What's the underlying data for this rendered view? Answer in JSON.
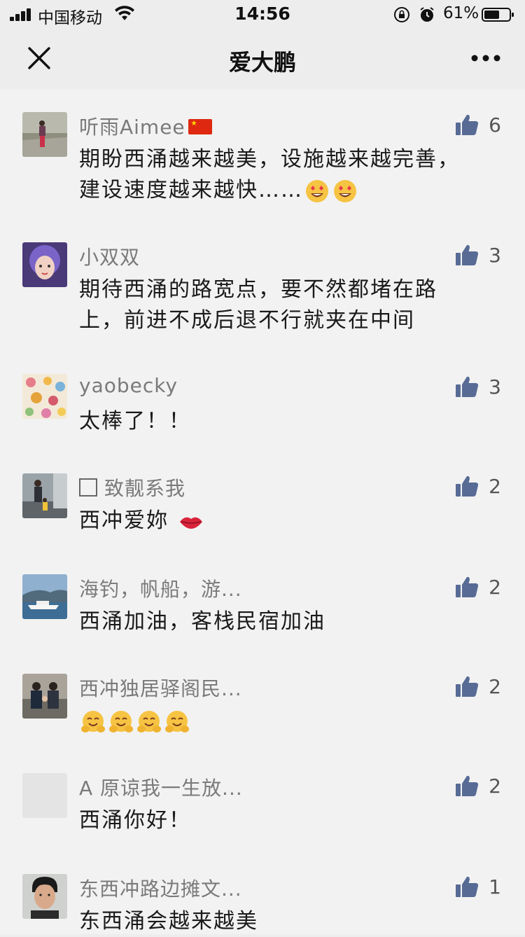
{
  "status": {
    "carrier": "中国移动",
    "time": "14:56",
    "battery": "61%",
    "battery_level": 0.61
  },
  "nav": {
    "title": "爱大鹏"
  },
  "comments": [
    {
      "name": "听雨Aimee",
      "text_1": "期盼西涌越来越美，设施越来越完善，",
      "text_2": "建设速度越来越快……",
      "likes": "6"
    },
    {
      "name": "小双双",
      "text_1": "期待西涌的路宽点，要不然都堵在路",
      "text_2": "上，前进不成后退不行就夹在中间",
      "likes": "3"
    },
    {
      "name": "yaobecky",
      "text_1": "太棒了！！",
      "likes": "3"
    },
    {
      "name": "致靓系我",
      "text_1": "西冲爱妳",
      "likes": "2"
    },
    {
      "name": "海钓，帆船，游...",
      "text_1": "西涌加油，客栈民宿加油",
      "likes": "2"
    },
    {
      "name": "西冲独居驿阁民...",
      "text_1": "",
      "likes": "2"
    },
    {
      "name": "A 原谅我一生放...",
      "text_1": "西涌你好！",
      "likes": "2"
    },
    {
      "name": "东西冲路边摊文...",
      "text_1": "东西涌会越来越美",
      "likes": "1"
    }
  ],
  "icons": {
    "like": "thumbs-up-icon",
    "close": "close-icon",
    "more": "more-icon",
    "emoji_heart_eyes": "heart-eyes-emoji",
    "emoji_lips": "lips-emoji",
    "emoji_hug": "hugging-emoji"
  },
  "colors": {
    "like_icon": "#576b95",
    "name_text": "#7a7a7a",
    "background": "#f2f2f2"
  }
}
